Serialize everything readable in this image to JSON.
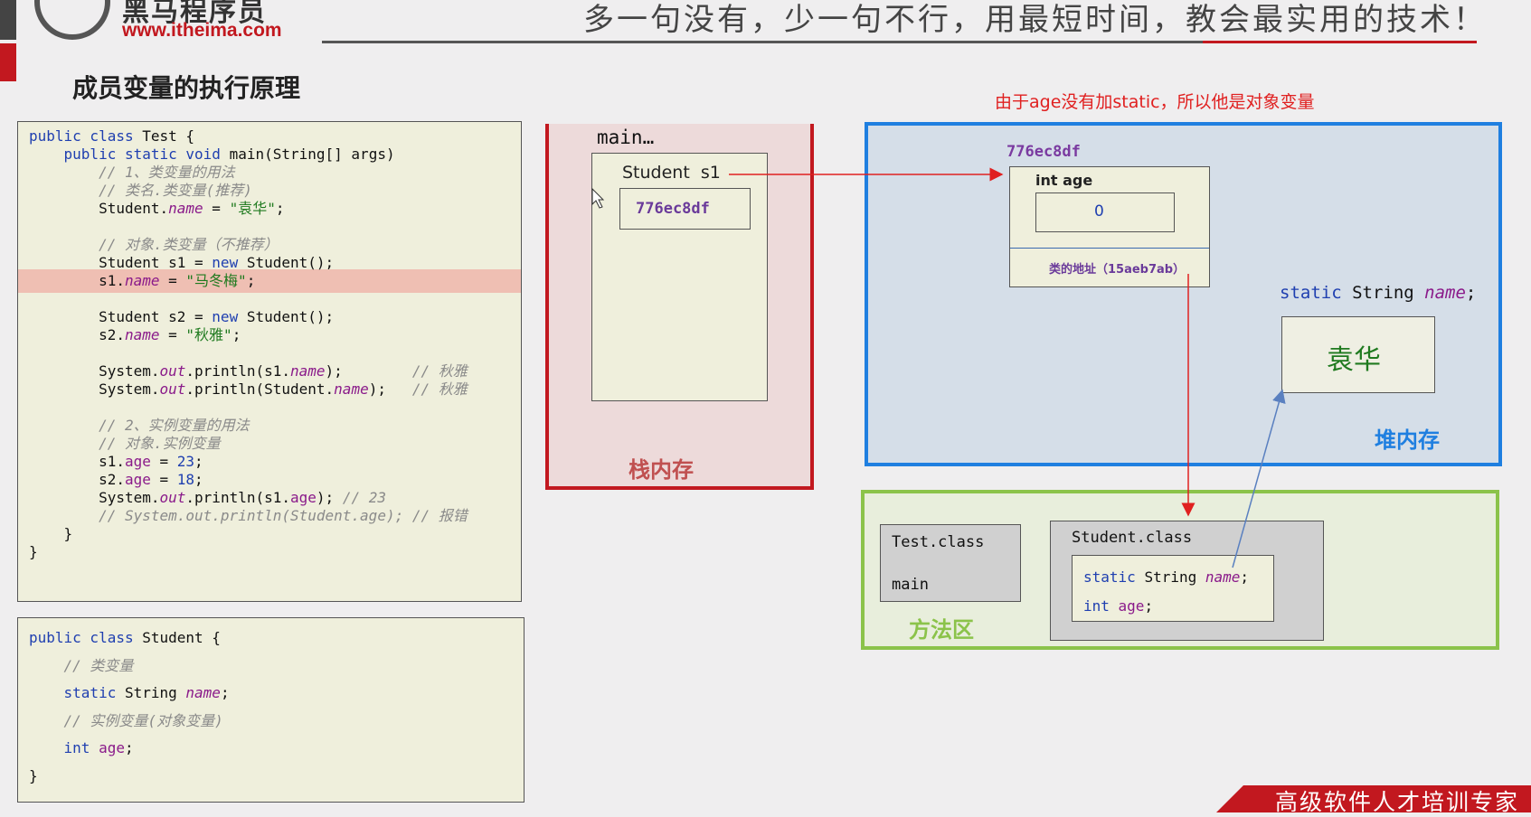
{
  "header": {
    "logo_text": "黑马程序员",
    "logo_url": "www.itheima.com",
    "slogan": "多一句没有，少一句不行，用最短时间，教会最实用的技术！"
  },
  "slide_title": "成员变量的执行原理",
  "note": "由于age没有加static，所以他是对象变量",
  "code_test": [
    [
      {
        "t": "public class ",
        "c": "kw"
      },
      {
        "t": "Test {"
      }
    ],
    [
      {
        "t": "    public static void ",
        "c": "kw"
      },
      {
        "t": "main(String[] args)"
      }
    ],
    [
      {
        "t": "        // 1、类变量的用法",
        "c": "cm"
      }
    ],
    [
      {
        "t": "        // 类名.类变量(推荐)",
        "c": "cm"
      }
    ],
    [
      {
        "t": "        Student."
      },
      {
        "t": "name",
        "c": "fld"
      },
      {
        "t": " = "
      },
      {
        "t": "\"袁华\"",
        "c": "str"
      },
      {
        "t": ";"
      }
    ],
    [
      {
        "t": ""
      }
    ],
    [
      {
        "t": "        // 对象.类变量（不推荐）",
        "c": "cm"
      }
    ],
    [
      {
        "t": "        Student s1 = "
      },
      {
        "t": "new ",
        "c": "kw"
      },
      {
        "t": "Student();"
      }
    ],
    [
      {
        "t": "        s1."
      },
      {
        "t": "name",
        "c": "fld"
      },
      {
        "t": " = "
      },
      {
        "t": "\"马冬梅\"",
        "c": "str"
      },
      {
        "t": ";"
      }
    ],
    [
      {
        "t": ""
      }
    ],
    [
      {
        "t": "        Student s2 = "
      },
      {
        "t": "new ",
        "c": "kw"
      },
      {
        "t": "Student();"
      }
    ],
    [
      {
        "t": "        s2."
      },
      {
        "t": "name",
        "c": "fld"
      },
      {
        "t": " = "
      },
      {
        "t": "\"秋雅\"",
        "c": "str"
      },
      {
        "t": ";"
      }
    ],
    [
      {
        "t": ""
      }
    ],
    [
      {
        "t": "        System."
      },
      {
        "t": "out",
        "c": "fld"
      },
      {
        "t": ".println(s1."
      },
      {
        "t": "name",
        "c": "fld"
      },
      {
        "t": ");        "
      },
      {
        "t": "// 秋雅",
        "c": "cm"
      }
    ],
    [
      {
        "t": "        System."
      },
      {
        "t": "out",
        "c": "fld"
      },
      {
        "t": ".println(Student."
      },
      {
        "t": "name",
        "c": "fld"
      },
      {
        "t": ");   "
      },
      {
        "t": "// 秋雅",
        "c": "cm"
      }
    ],
    [
      {
        "t": ""
      }
    ],
    [
      {
        "t": "        // 2、实例变量的用法",
        "c": "cm"
      }
    ],
    [
      {
        "t": "        // 对象.实例变量",
        "c": "cm"
      }
    ],
    [
      {
        "t": "        s1."
      },
      {
        "t": "age",
        "c": "fld2"
      },
      {
        "t": " = "
      },
      {
        "t": "23",
        "c": "num"
      },
      {
        "t": ";"
      }
    ],
    [
      {
        "t": "        s2."
      },
      {
        "t": "age",
        "c": "fld2"
      },
      {
        "t": " = "
      },
      {
        "t": "18",
        "c": "num"
      },
      {
        "t": ";"
      }
    ],
    [
      {
        "t": "        System."
      },
      {
        "t": "out",
        "c": "fld"
      },
      {
        "t": ".println(s1."
      },
      {
        "t": "age",
        "c": "fld2"
      },
      {
        "t": "); "
      },
      {
        "t": "// 23",
        "c": "cm"
      }
    ],
    [
      {
        "t": "        // System.out.println(Student.age); // 报错",
        "c": "cm"
      }
    ],
    [
      {
        "t": "    }"
      }
    ],
    [
      {
        "t": "}"
      }
    ]
  ],
  "highlighted_line": 8,
  "code_student": [
    [
      {
        "t": "public class ",
        "c": "kw"
      },
      {
        "t": "Student {"
      }
    ],
    [
      {
        "t": "    // 类变量",
        "c": "cm"
      }
    ],
    [
      {
        "t": "    "
      },
      {
        "t": "static ",
        "c": "kw"
      },
      {
        "t": "String "
      },
      {
        "t": "name",
        "c": "fld"
      },
      {
        "t": ";"
      }
    ],
    [
      {
        "t": "    // 实例变量(对象变量)",
        "c": "cm"
      }
    ],
    [
      {
        "t": "    "
      },
      {
        "t": "int ",
        "c": "kw"
      },
      {
        "t": "age",
        "c": "fld2"
      },
      {
        "t": ";"
      }
    ],
    [
      {
        "t": "}"
      }
    ]
  ],
  "stack": {
    "frame_title": "main…",
    "var_label": "Student  s1",
    "var_value": "776ec8df",
    "label": "栈内存"
  },
  "heap": {
    "object_address": "776ec8df",
    "field_label": "int age",
    "field_value": "0",
    "class_address": "类的地址（15aeb7ab）",
    "static_decl": {
      "kw": "static ",
      "type": "String ",
      "name": "name",
      ";": ";"
    },
    "static_value": "袁华",
    "label": "堆内存"
  },
  "method_area": {
    "test_class": "Test.class",
    "test_main": "main",
    "student_class": "Student.class",
    "line1": {
      "kw": "static ",
      "type": "String ",
      "name": "name",
      "end": ";"
    },
    "line2": {
      "kw": "int ",
      "name": "age",
      "end": ";"
    },
    "label": "方法区"
  },
  "footer": "高级软件人才培训专家",
  "colors": {
    "stack_border": "#c2181f",
    "heap_border": "#1f7fe0",
    "method_border": "#8bc34a",
    "arrow_red": "#e02020",
    "arrow_blue": "#5a80c0"
  }
}
